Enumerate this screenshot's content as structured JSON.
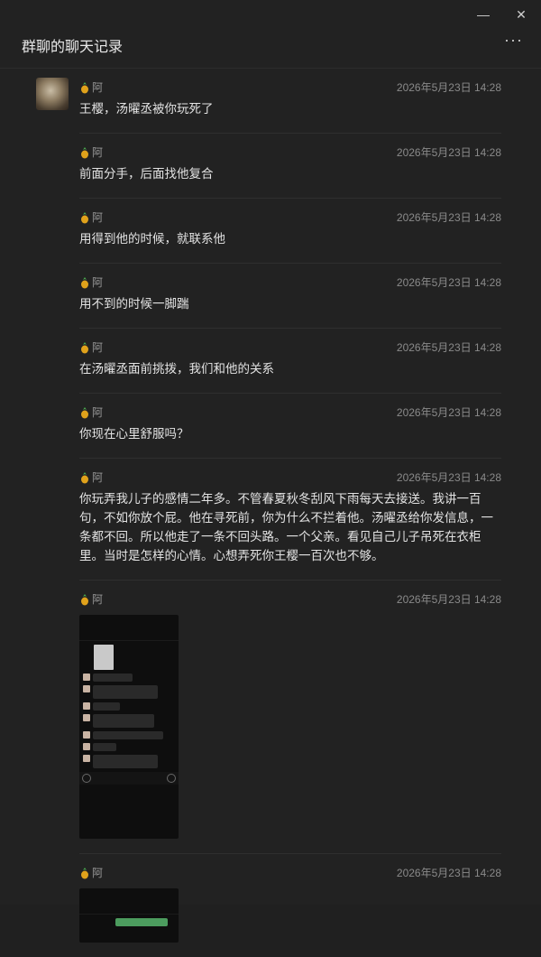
{
  "window": {
    "minimize_icon": "minimize-icon",
    "close_icon": "close-icon"
  },
  "header": {
    "title": "群聊的聊天记录",
    "more_icon": "more-icon"
  },
  "messages": [
    {
      "sender": "阿",
      "time": "2026年5月23日 14:28",
      "text": "王樱，汤曜丞被你玩死了"
    },
    {
      "sender": "阿",
      "time": "2026年5月23日 14:28",
      "text": "前面分手，后面找他复合"
    },
    {
      "sender": "阿",
      "time": "2026年5月23日 14:28",
      "text": "用得到他的时候，就联系他"
    },
    {
      "sender": "阿",
      "time": "2026年5月23日 14:28",
      "text": "用不到的时候一脚踹"
    },
    {
      "sender": "阿",
      "time": "2026年5月23日 14:28",
      "text": "在汤曜丞面前挑拨，我们和他的关系"
    },
    {
      "sender": "阿",
      "time": "2026年5月23日 14:28",
      "text": "你现在心里舒服吗？"
    },
    {
      "sender": "阿",
      "time": "2026年5月23日 14:28",
      "text": "你玩弄我儿子的感情二年多。不管春夏秋冬刮风下雨每天去接送。我讲一百句，不如你放个屁。他在寻死前，你为什么不拦着他。汤曜丞给你发信息，一条都不回。所以他走了一条不回头路。一个父亲。看见自己儿子吊死在衣柜里。当时是怎样的心情。心想弄死你王樱一百次也不够。"
    },
    {
      "sender": "阿",
      "time": "2026年5月23日 14:28",
      "image": "chat-screenshot"
    },
    {
      "sender": "阿",
      "time": "2026年5月23日 14:28",
      "image": "chat-screenshot"
    }
  ]
}
